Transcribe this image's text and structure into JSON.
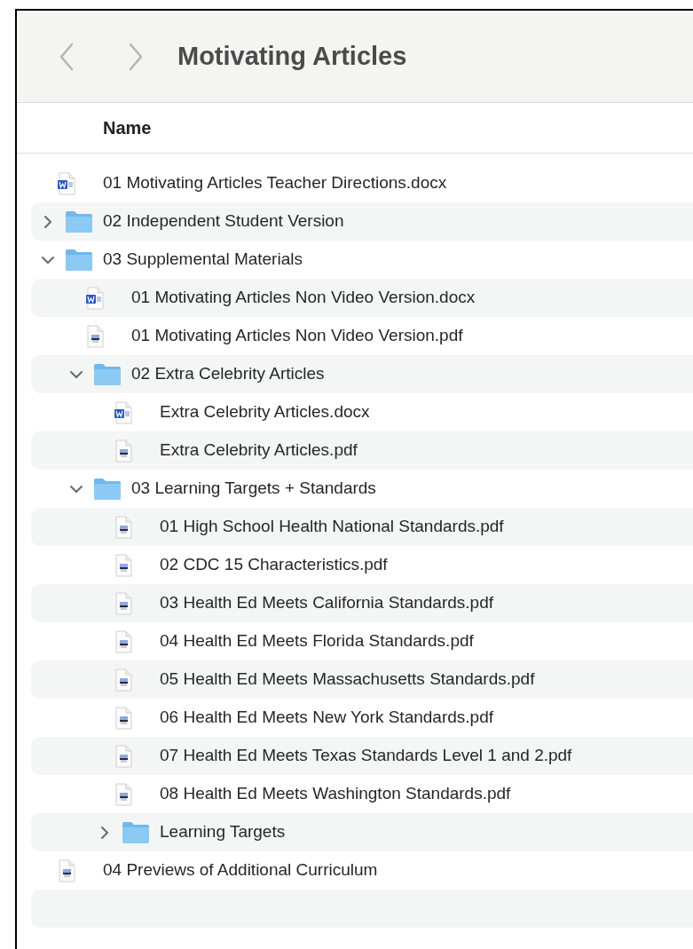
{
  "window": {
    "title": "Motivating Articles"
  },
  "table": {
    "columns": [
      "Name"
    ],
    "rows": [
      {
        "kind": "doc",
        "name": "01 Motivating Articles Teacher Directions.docx"
      },
      {
        "kind": "folder",
        "name": "02 Independent Student Version",
        "expanded": false
      },
      {
        "kind": "folder",
        "name": "03 Supplemental Materials",
        "expanded": true,
        "children": [
          {
            "kind": "doc",
            "name": "01 Motivating Articles Non Video Version.docx"
          },
          {
            "kind": "pdf",
            "name": "01 Motivating Articles Non Video Version.pdf"
          },
          {
            "kind": "folder",
            "name": "02 Extra Celebrity Articles",
            "expanded": true,
            "children": [
              {
                "kind": "doc",
                "name": "Extra Celebrity Articles.docx"
              },
              {
                "kind": "pdf",
                "name": "Extra Celebrity Articles.pdf"
              }
            ]
          },
          {
            "kind": "folder",
            "name": "03 Learning Targets + Standards",
            "expanded": true,
            "children": [
              {
                "kind": "pdf",
                "name": "01 High School Health National Standards.pdf"
              },
              {
                "kind": "pdf",
                "name": "02 CDC 15 Characteristics.pdf"
              },
              {
                "kind": "pdf",
                "name": "03 Health Ed Meets California Standards.pdf"
              },
              {
                "kind": "pdf",
                "name": "04 Health Ed Meets Florida Standards.pdf"
              },
              {
                "kind": "pdf",
                "name": "05 Health Ed Meets Massachusetts Standards.pdf"
              },
              {
                "kind": "pdf",
                "name": "06 Health Ed Meets New York Standards.pdf"
              },
              {
                "kind": "pdf",
                "name": "07 Health Ed Meets Texas Standards Level 1 and 2.pdf"
              },
              {
                "kind": "pdf",
                "name": "08 Health Ed Meets Washington Standards.pdf"
              },
              {
                "kind": "folder",
                "name": "Learning Targets",
                "expanded": false
              }
            ]
          }
        ]
      },
      {
        "kind": "pdf",
        "name": "04 Previews of Additional Curriculum"
      }
    ]
  }
}
